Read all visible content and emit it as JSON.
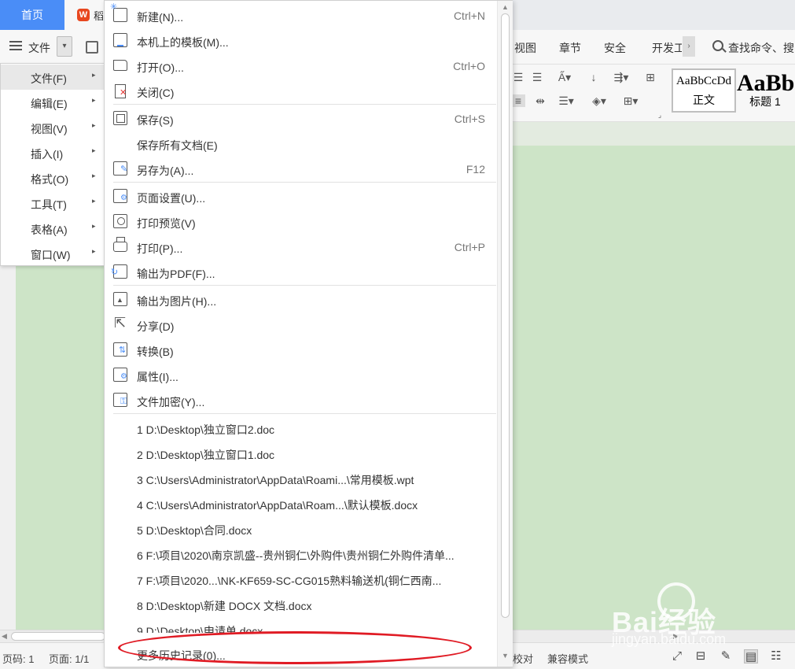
{
  "tabs": {
    "home": "首页",
    "doc": "稻"
  },
  "toolbar": {
    "file_label": "文件",
    "tabs": [
      "视图",
      "章节",
      "安全",
      "开发工"
    ],
    "search_text": "查找命令、搜"
  },
  "ribbon": {
    "styles": [
      {
        "sample": "AaBbCcDd",
        "name": "正文"
      },
      {
        "sample": "AaBb",
        "name": "标题 1"
      }
    ]
  },
  "left_menu": {
    "items": [
      {
        "label": "文件(F)",
        "active": true
      },
      {
        "label": "编辑(E)"
      },
      {
        "label": "视图(V)"
      },
      {
        "label": "插入(I)"
      },
      {
        "label": "格式(O)"
      },
      {
        "label": "工具(T)"
      },
      {
        "label": "表格(A)"
      },
      {
        "label": "窗口(W)"
      }
    ]
  },
  "file_menu": {
    "items": [
      {
        "label": "新建(N)...",
        "shortcut": "Ctrl+N",
        "icon": "new-icon"
      },
      {
        "label": "本机上的模板(M)...",
        "shortcut": "",
        "icon": "template-icon"
      },
      {
        "label": "打开(O)...",
        "shortcut": "Ctrl+O",
        "icon": "folder-icon"
      },
      {
        "label": "关闭(C)",
        "shortcut": "",
        "icon": "close-doc-icon"
      },
      {
        "label": "保存(S)",
        "shortcut": "Ctrl+S",
        "icon": "save-icon"
      },
      {
        "label": "保存所有文档(E)",
        "shortcut": "",
        "icon": ""
      },
      {
        "label": "另存为(A)...",
        "shortcut": "F12",
        "icon": "save-as-icon"
      },
      {
        "label": "页面设置(U)...",
        "shortcut": "",
        "icon": "page-setup-icon"
      },
      {
        "label": "打印预览(V)",
        "shortcut": "",
        "icon": "print-preview-icon"
      },
      {
        "label": "打印(P)...",
        "shortcut": "Ctrl+P",
        "icon": "printer-icon"
      },
      {
        "label": "输出为PDF(F)...",
        "shortcut": "",
        "icon": "pdf-export-icon"
      },
      {
        "label": "输出为图片(H)...",
        "shortcut": "",
        "icon": "image-export-icon"
      },
      {
        "label": "分享(D)",
        "shortcut": "",
        "icon": "share-icon"
      },
      {
        "label": "转换(B)",
        "shortcut": "",
        "icon": "convert-icon"
      },
      {
        "label": "属性(I)...",
        "shortcut": "",
        "icon": "properties-icon"
      },
      {
        "label": "文件加密(Y)...",
        "shortcut": "",
        "icon": "encrypt-icon"
      }
    ],
    "recent": [
      "1 D:\\Desktop\\独立窗口2.doc",
      "2 D:\\Desktop\\独立窗口1.doc",
      "3 C:\\Users\\Administrator\\AppData\\Roami...\\常用模板.wpt",
      "4 C:\\Users\\Administrator\\AppData\\Roam...\\默认模板.docx",
      "5 D:\\Desktop\\合同.docx",
      "6 F:\\项目\\2020\\南京凯盛--贵州铜仁\\外购件\\贵州铜仁外购件清单...",
      "7 F:\\项目\\2020...\\NK-KF659-SC-CG015熟料输送机(铜仁西南...",
      "8 D:\\Desktop\\新建 DOCX 文档.docx",
      "9 D:\\Desktop\\申请单.docx"
    ],
    "more_history": "更多历史记录(0)..."
  },
  "statusbar": {
    "page_code": "页码: 1",
    "page_count": "页面: 1/1",
    "proofread": "校对",
    "compat_mode": "兼容模式"
  },
  "watermark": {
    "brand": "Bai经验",
    "url": "jingyan.baidu.com"
  },
  "colors": {
    "accent": "#4a8df7",
    "doc_bg": "#cde4c7",
    "highlight": "#e01b24"
  }
}
